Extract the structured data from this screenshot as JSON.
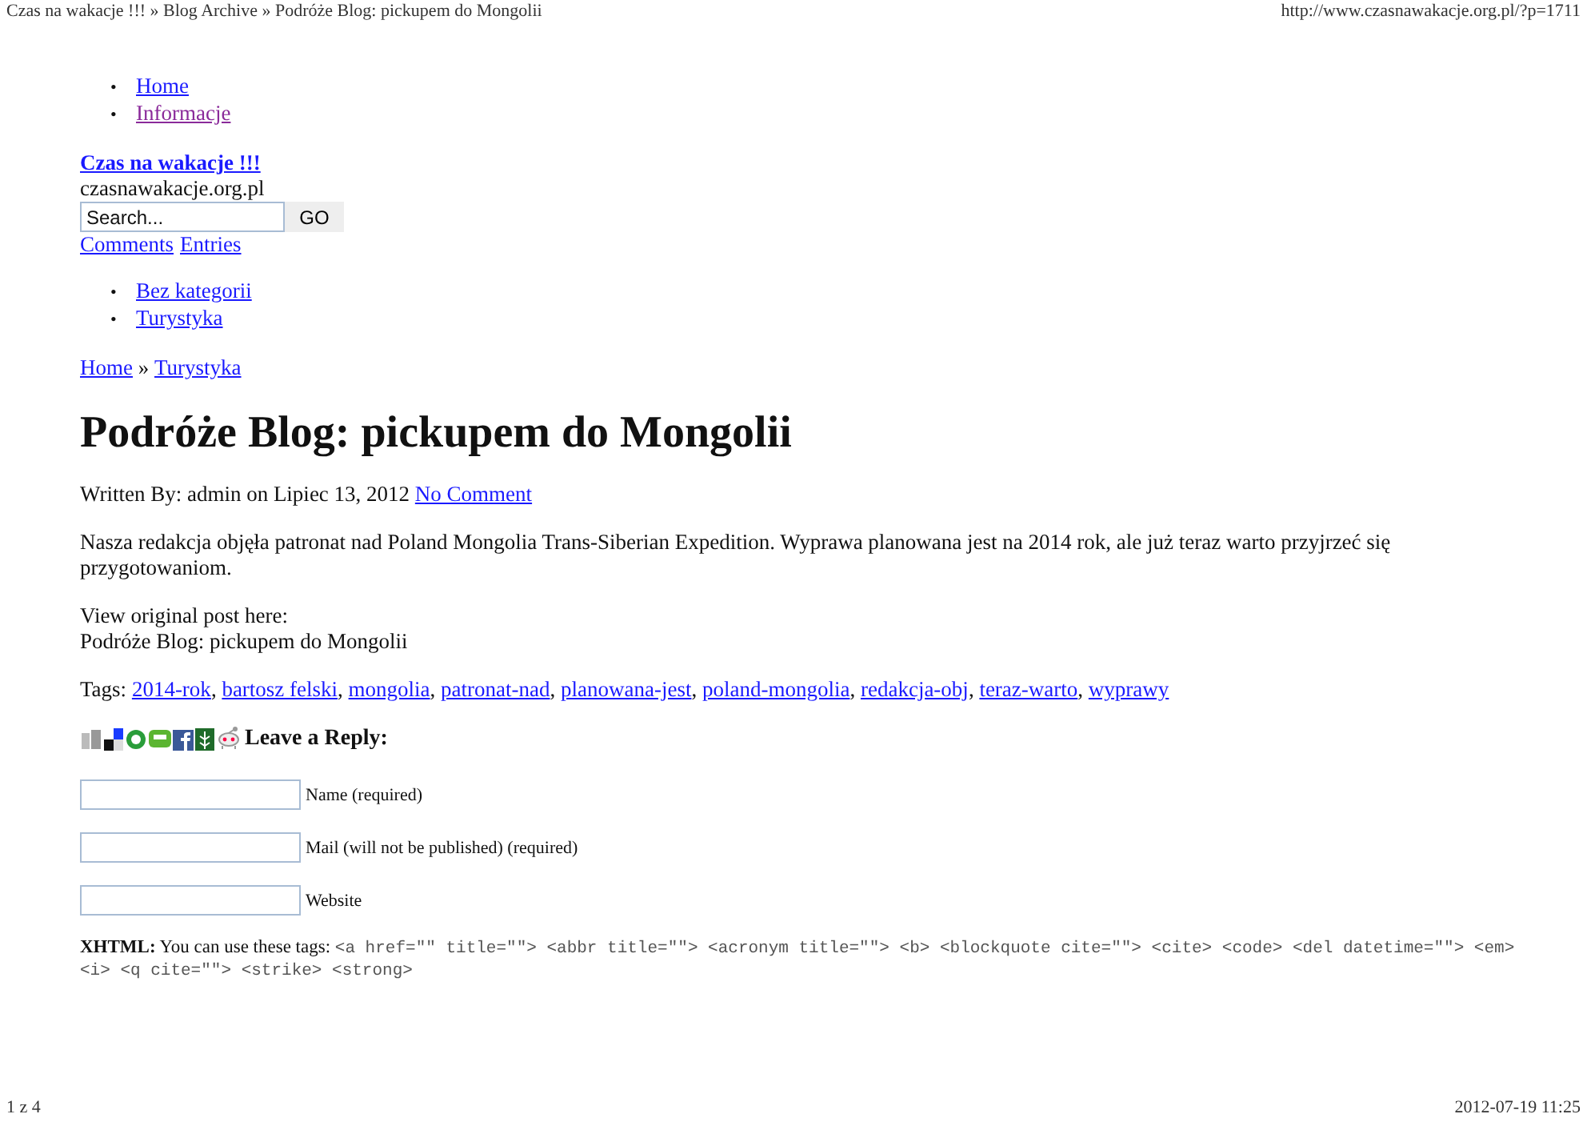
{
  "print_header": {
    "title": "Czas na wakacje !!! » Blog Archive » Podróże Blog: pickupem do Mongolii",
    "url": "http://www.czasnawakacje.org.pl/?p=1711"
  },
  "bullet": "•",
  "breadcrumb_separator": "»",
  "tag_separator": ",",
  "nav": [
    {
      "label": "Home",
      "visited": false
    },
    {
      "label": "Informacje",
      "visited": true
    }
  ],
  "site": {
    "title": "Czas na wakacje !!!",
    "tagline": "czasnawakacje.org.pl"
  },
  "search": {
    "placeholder": "Search...",
    "button": "GO"
  },
  "feeds": [
    "Comments",
    "Entries"
  ],
  "categories": [
    "Bez kategorii",
    "Turystyka"
  ],
  "breadcrumb": [
    "Home",
    "Turystyka"
  ],
  "post": {
    "title": "Podróże Blog: pickupem do Mongolii",
    "meta": "Written By: admin on Lipiec 13, 2012",
    "comments_link": "No Comment",
    "body": "Nasza redakcja objęła patronat nad Poland Mongolia Trans-Siberian Expedition. Wyprawa planowana jest na 2014 rok, ale już teraz warto przyjrzeć się przygotowaniom.",
    "source_label": "View original post here:",
    "source_title": "Podróże Blog: pickupem do Mongolii",
    "tags_label": "Tags:",
    "tags": [
      "2014-rok",
      "bartosz felski",
      "mongolia",
      "patronat-nad",
      "planowana-jest",
      "poland-mongolia",
      "redakcja-obj",
      "teraz-warto",
      "wyprawy"
    ]
  },
  "reply": {
    "heading": "Leave a Reply:",
    "fields": [
      {
        "label": "Name (required)"
      },
      {
        "label": "Mail (will not be published) (required)"
      },
      {
        "label": "Website"
      }
    ],
    "xhtml_label": "XHTML:",
    "xhtml_text": "You can use these tags:",
    "xhtml_tags": "<a href=\"\" title=\"\"> <abbr title=\"\"> <acronym title=\"\"> <b> <blockquote cite=\"\"> <cite> <code> <del datetime=\"\"> <em> <i> <q cite=\"\"> <strike> <strong>"
  },
  "print_footer": {
    "page": "1 z 4",
    "datetime": "2012-07-19 11:25"
  }
}
